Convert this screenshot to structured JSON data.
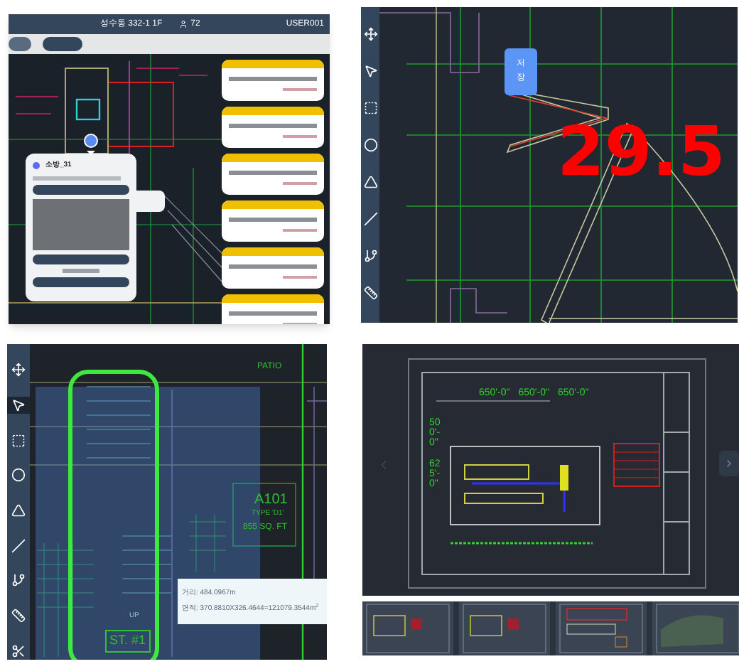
{
  "site_panel": {
    "title": "성수동 332-1 1F",
    "user_count": "72",
    "user_id": "USER001",
    "pill_buttons": [
      {
        "selected": false
      },
      {
        "selected": true
      }
    ],
    "popup": {
      "name": "소방_31"
    },
    "cards": [
      {
        "color": "#f0c000"
      },
      {
        "color": "#f0c000"
      },
      {
        "color": "#f0c000"
      },
      {
        "color": "#f0c000"
      },
      {
        "color": "#f0c000"
      },
      {
        "color": "#f0c000"
      }
    ]
  },
  "measure_panel": {
    "tools": [
      {
        "kind": "move",
        "selected": false
      },
      {
        "kind": "pointer",
        "selected": false
      },
      {
        "kind": "rect",
        "selected": false
      },
      {
        "kind": "circle",
        "selected": false
      },
      {
        "kind": "triangle",
        "selected": false
      },
      {
        "kind": "line",
        "selected": false
      },
      {
        "kind": "polyline",
        "selected": false
      },
      {
        "kind": "ruler",
        "selected": false
      }
    ],
    "save_label": "저장",
    "angle": "29.5"
  },
  "plan_panel": {
    "tools": [
      {
        "kind": "move",
        "selected": false
      },
      {
        "kind": "pointer",
        "selected": true
      },
      {
        "kind": "rect",
        "selected": false
      },
      {
        "kind": "circle",
        "selected": false
      },
      {
        "kind": "triangle",
        "selected": false
      },
      {
        "kind": "line",
        "selected": false
      },
      {
        "kind": "polyline",
        "selected": false
      },
      {
        "kind": "ruler",
        "selected": false
      },
      {
        "kind": "cut",
        "selected": false
      }
    ],
    "patio": "PATIO",
    "room": "A101",
    "room_type": "TYPE 'D1'",
    "area": "855 SQ. FT",
    "stair": "ST. #1",
    "up": "UP",
    "tooltip": [
      "거리: 484.0967m",
      "면적: 370.8810X326.4644=121079.3544m$^{2}$"
    ]
  },
  "sheet_panel": {
    "dims_horizontal": [
      "650'-0\"",
      "650'-0\"",
      "650'-0\""
    ],
    "dims_vertical": [
      "500'-0\"",
      "625'-0\""
    ],
    "thumbnails": [
      {
        "kind": "plan"
      },
      {
        "kind": "plan"
      },
      {
        "kind": "table"
      },
      {
        "kind": "map"
      }
    ]
  }
}
